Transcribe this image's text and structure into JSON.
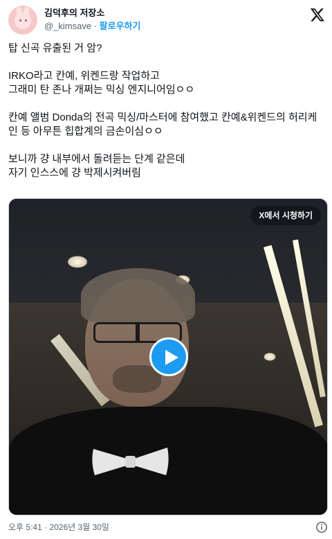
{
  "author": {
    "display_name": "김덕후의 저장소",
    "handle": "@_kimsave",
    "separator": " · ",
    "follow_label": "팔로우하기",
    "avatar_icon": "rabbit-avatar-icon"
  },
  "brand": {
    "logo_icon": "x-logo-icon",
    "color": "#0f1419"
  },
  "tweet": {
    "paragraphs": [
      "탑 신곡 유출된 거 암?",
      "IRKO라고 칸예, 위켄드랑 작업하고\n그래미 탄 존나 개쩌는 믹싱 엔지니어임ㅇㅇ",
      "칸예 앨범 Donda의 전곡 믹싱/마스터에 참여했고 칸예&위켄드의 허리케인 등 아무튼 힙합계의 금손이심ㅇㅇ",
      "보니까 걍 내부에서 돌려듣는 단계 같은데\n자기 인스스에 걍 박제시켜버림"
    ]
  },
  "media": {
    "watch_on_x_label": "X에서 시청하기",
    "play_icon": "play-icon"
  },
  "footer": {
    "timestamp": "오후 5:41 · 2026년 3월 30일",
    "info_icon": "info-icon"
  },
  "colors": {
    "accent": "#1d9bf0",
    "secondary_text": "#536471",
    "primary_text": "#0f1419"
  }
}
